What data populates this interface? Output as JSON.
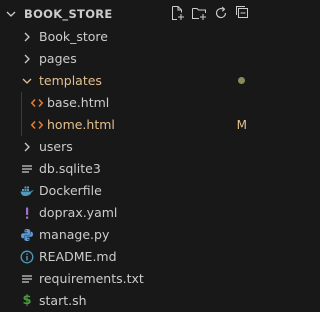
{
  "explorer": {
    "title": "BOOK_STORE",
    "actions": [
      "new-file-icon",
      "new-folder-icon",
      "refresh-icon",
      "collapse-all-icon"
    ]
  },
  "items": [
    {
      "label": "Book_store",
      "kind": "folder",
      "expanded": false
    },
    {
      "label": "pages",
      "kind": "folder",
      "expanded": false
    },
    {
      "label": "templates",
      "kind": "folder",
      "expanded": true,
      "decoration": "dot"
    },
    {
      "label": "base.html",
      "kind": "html"
    },
    {
      "label": "home.html",
      "kind": "html",
      "status": "M"
    },
    {
      "label": "users",
      "kind": "folder",
      "expanded": false
    },
    {
      "label": "db.sqlite3",
      "kind": "file"
    },
    {
      "label": "Dockerfile",
      "kind": "docker"
    },
    {
      "label": "doprax.yaml",
      "kind": "yaml"
    },
    {
      "label": "manage.py",
      "kind": "python"
    },
    {
      "label": "README.md",
      "kind": "info"
    },
    {
      "label": "requirements.txt",
      "kind": "text"
    },
    {
      "label": "start.sh",
      "kind": "shell"
    }
  ],
  "colors": {
    "background": "#181818",
    "text": "#cccccc",
    "modified_text": "#e2c08d",
    "html_icon": "#e37933",
    "docker_icon": "#519aba",
    "yaml_icon": "#a074c4",
    "python_icon": "#5c9ad8",
    "info_icon": "#519aba",
    "shell_icon": "#4d9a3d",
    "dot": "#8a8a5c"
  }
}
